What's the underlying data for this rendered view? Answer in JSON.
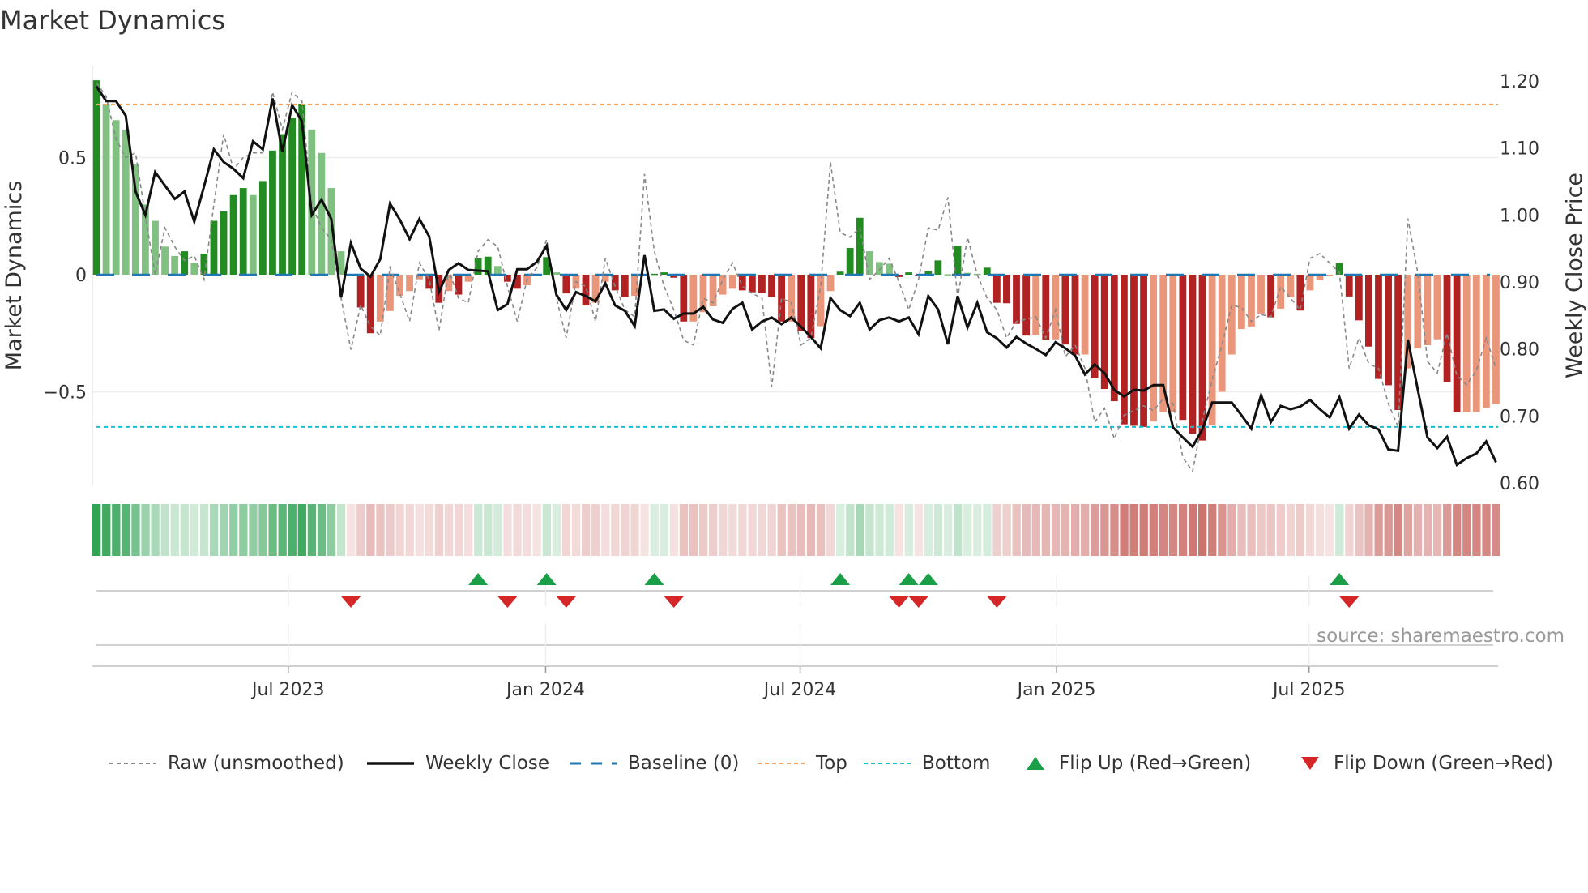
{
  "title": "Market Dynamics",
  "source_note": "source: sharemaestro.com",
  "colors": {
    "up_strong": "#228b22",
    "up_weak": "#80c080",
    "down_strong": "#b22222",
    "down_weak": "#e9967a",
    "raw": "#888888",
    "close": "#111111",
    "baseline": "#1f77b4",
    "top": "#f4a460",
    "bottom": "#17becf",
    "flip_up": "#1a9e48",
    "flip_down": "#d62728",
    "strip_green": "#31a354",
    "strip_red": "#c8645f"
  },
  "legend": [
    {
      "key": "raw",
      "label": "Raw (unsmoothed)"
    },
    {
      "key": "close",
      "label": "Weekly Close"
    },
    {
      "key": "baseline",
      "label": "Baseline (0)"
    },
    {
      "key": "top",
      "label": "Top"
    },
    {
      "key": "bottom",
      "label": "Bottom"
    },
    {
      "key": "flip_up",
      "label": "Flip Up (Red→Green)"
    },
    {
      "key": "flip_down",
      "label": "Flip Down (Green→Red)"
    }
  ],
  "chart_data": {
    "type": "bar",
    "title": "Market Dynamics",
    "ylabel": "Market Dynamics",
    "y2label": "Weekly Close Price",
    "ylim": [
      -0.72,
      0.88
    ],
    "y2lim": [
      0.6,
      1.2
    ],
    "yticks": [
      {
        "v": 0.5,
        "label": "0.5"
      },
      {
        "v": 0,
        "label": "0"
      },
      {
        "v": -0.5,
        "label": "−0.5"
      }
    ],
    "y2ticks": [
      {
        "v": 1.2,
        "label": "1.20"
      },
      {
        "v": 1.1,
        "label": "1.10"
      },
      {
        "v": 1.0,
        "label": "1.00"
      },
      {
        "v": 0.9,
        "label": "0.90"
      },
      {
        "v": 0.8,
        "label": "0.80"
      },
      {
        "v": 0.7,
        "label": "0.70"
      },
      {
        "v": 0.6,
        "label": "0.60"
      }
    ],
    "xticks": [
      {
        "week": 19.6,
        "label": "Jul 2023"
      },
      {
        "week": 45.9,
        "label": "Jan 2024"
      },
      {
        "week": 71.9,
        "label": "Jul 2024"
      },
      {
        "week": 98.1,
        "label": "Jan 2025"
      },
      {
        "week": 123.9,
        "label": "Jul 2025"
      }
    ],
    "top_level": 0.727,
    "bottom_level": -0.65,
    "baseline": 0,
    "grid": true,
    "legend_position": "bottom",
    "dynamics": [
      0.83,
      0.73,
      0.66,
      0.62,
      0.47,
      0.3,
      0.23,
      0.12,
      0.08,
      0.1,
      0.05,
      0.09,
      0.23,
      0.27,
      0.34,
      0.37,
      0.34,
      0.4,
      0.53,
      0.6,
      0.67,
      0.73,
      0.62,
      0.52,
      0.37,
      0.1,
      -0.005,
      -0.14,
      -0.25,
      -0.2,
      -0.155,
      -0.09,
      -0.07,
      -0.02,
      -0.06,
      -0.12,
      -0.07,
      -0.085,
      -0.03,
      0.07,
      0.077,
      0.037,
      -0.03,
      -0.06,
      -0.045,
      -0.003,
      0.075,
      0.01,
      -0.08,
      -0.06,
      -0.13,
      -0.12,
      -0.03,
      -0.067,
      -0.095,
      -0.09,
      -0.002,
      0.004,
      0.01,
      -0.013,
      -0.2,
      -0.2,
      -0.16,
      -0.135,
      -0.085,
      -0.06,
      -0.067,
      -0.075,
      -0.078,
      -0.095,
      -0.2,
      -0.2,
      -0.24,
      -0.27,
      -0.22,
      -0.07,
      0.013,
      0.114,
      0.243,
      0.1,
      0.054,
      0.047,
      -0.01,
      0.01,
      -0.003,
      0.015,
      0.061,
      0.002,
      0.122,
      0.008,
      0.004,
      0.03,
      -0.12,
      -0.122,
      -0.21,
      -0.26,
      -0.257,
      -0.28,
      -0.276,
      -0.298,
      -0.341,
      -0.341,
      -0.442,
      -0.488,
      -0.54,
      -0.639,
      -0.645,
      -0.65,
      -0.627,
      -0.586,
      -0.586,
      -0.62,
      -0.68,
      -0.708,
      -0.644,
      -0.5,
      -0.341,
      -0.232,
      -0.221,
      -0.166,
      -0.182,
      -0.145,
      -0.096,
      -0.153,
      -0.067,
      -0.024,
      -0.003,
      0.05,
      -0.093,
      -0.195,
      -0.307,
      -0.445,
      -0.472,
      -0.578,
      -0.4,
      -0.315,
      -0.301,
      -0.276,
      -0.46,
      -0.587,
      -0.587,
      -0.586,
      -0.569,
      -0.552
    ],
    "raw": [
      0.82,
      0.76,
      0.58,
      0.5,
      0.52,
      0.25,
      0.0,
      0.2,
      0.12,
      0.06,
      0.08,
      -0.02,
      0.3,
      0.6,
      0.45,
      0.5,
      0.52,
      0.52,
      0.78,
      0.62,
      0.78,
      0.74,
      0.3,
      0.2,
      0.15,
      -0.1,
      -0.32,
      -0.13,
      -0.22,
      -0.26,
      0.03,
      -0.08,
      -0.2,
      0.05,
      -0.02,
      -0.24,
      0.02,
      -0.1,
      -0.12,
      0.1,
      0.15,
      0.12,
      -0.05,
      -0.2,
      -0.02,
      0.03,
      0.15,
      -0.1,
      -0.27,
      -0.03,
      -0.05,
      -0.2,
      0.07,
      -0.05,
      -0.15,
      -0.18,
      0.43,
      0.1,
      -0.05,
      -0.15,
      -0.28,
      -0.3,
      -0.1,
      -0.12,
      -0.02,
      0.05,
      -0.05,
      -0.08,
      -0.1,
      -0.48,
      -0.1,
      -0.12,
      -0.3,
      -0.27,
      -0.05,
      0.48,
      0.18,
      0.16,
      0.2,
      -0.02,
      0.02,
      0.07,
      -0.03,
      -0.15,
      -0.02,
      0.2,
      0.19,
      0.33,
      -0.1,
      0.16,
      0.0,
      -0.1,
      -0.15,
      -0.27,
      -0.2,
      -0.19,
      -0.18,
      -0.27,
      -0.15,
      -0.35,
      -0.3,
      -0.4,
      -0.63,
      -0.57,
      -0.7,
      -0.6,
      -0.58,
      -0.56,
      -0.58,
      -0.53,
      -0.55,
      -0.78,
      -0.84,
      -0.62,
      -0.45,
      -0.3,
      -0.13,
      -0.14,
      -0.2,
      -0.17,
      -0.18,
      -0.05,
      -0.1,
      -0.15,
      0.07,
      0.09,
      0.05,
      0.01,
      -0.4,
      -0.27,
      -0.38,
      -0.4,
      -0.55,
      -0.65,
      0.24,
      0.01,
      -0.37,
      -0.42,
      -0.25,
      -0.43,
      -0.47,
      -0.41,
      -0.27,
      -0.4
    ],
    "close": [
      1.192,
      1.17,
      1.17,
      1.148,
      1.035,
      1.0,
      1.064,
      1.044,
      1.024,
      1.035,
      0.99,
      1.043,
      1.098,
      1.079,
      1.069,
      1.055,
      1.11,
      1.098,
      1.174,
      1.094,
      1.164,
      1.14,
      1.0,
      1.023,
      0.994,
      0.877,
      0.958,
      0.92,
      0.908,
      0.934,
      1.017,
      0.993,
      0.964,
      0.994,
      0.968,
      0.885,
      0.918,
      0.928,
      0.918,
      0.917,
      0.916,
      0.858,
      0.867,
      0.919,
      0.919,
      0.93,
      0.954,
      0.881,
      0.858,
      0.885,
      0.879,
      0.871,
      0.898,
      0.865,
      0.857,
      0.834,
      0.94,
      0.857,
      0.859,
      0.845,
      0.853,
      0.853,
      0.863,
      0.844,
      0.839,
      0.86,
      0.869,
      0.829,
      0.841,
      0.847,
      0.837,
      0.847,
      0.833,
      0.818,
      0.801,
      0.876,
      0.858,
      0.849,
      0.869,
      0.829,
      0.843,
      0.847,
      0.841,
      0.847,
      0.822,
      0.879,
      0.859,
      0.807,
      0.879,
      0.832,
      0.869,
      0.825,
      0.816,
      0.802,
      0.818,
      0.808,
      0.8,
      0.791,
      0.81,
      0.801,
      0.79,
      0.762,
      0.777,
      0.764,
      0.739,
      0.729,
      0.739,
      0.738,
      0.746,
      0.746,
      0.683,
      0.668,
      0.654,
      0.68,
      0.72,
      0.72,
      0.72,
      0.701,
      0.681,
      0.731,
      0.691,
      0.715,
      0.71,
      0.714,
      0.724,
      0.71,
      0.698,
      0.728,
      0.681,
      0.702,
      0.686,
      0.68,
      0.65,
      0.648,
      0.814,
      0.74,
      0.668,
      0.652,
      0.669,
      0.627,
      0.637,
      0.644,
      0.662,
      0.631
    ],
    "flip_up_weeks": [
      39,
      46,
      57,
      76,
      83,
      85,
      127
    ],
    "flip_down_weeks": [
      26,
      42,
      48,
      59,
      82,
      84,
      92,
      128
    ]
  }
}
